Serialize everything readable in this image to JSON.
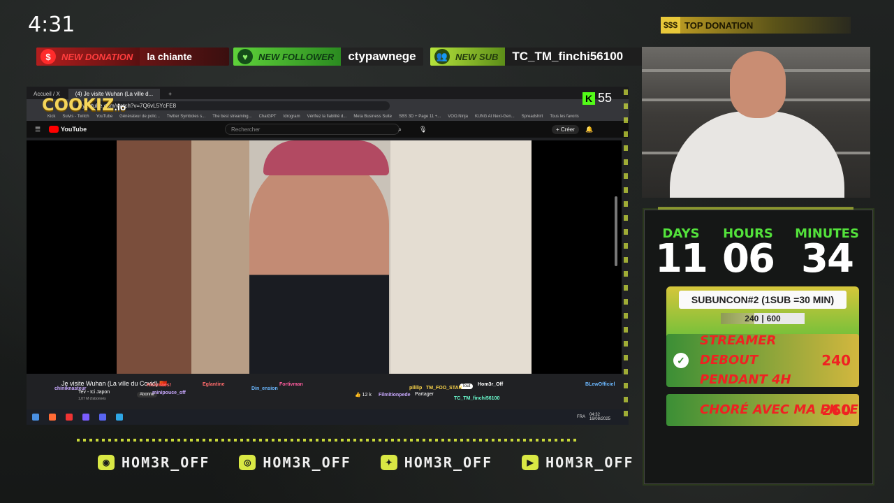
{
  "clock": "4:31",
  "alerts": {
    "donation": {
      "label": "NEW DONATION",
      "value": "la chiante"
    },
    "follower": {
      "label": "NEW FOLLOWER",
      "value": "ctypawnege"
    },
    "sub": {
      "label": "NEW SUB",
      "value": "TC_TM_finchi56100"
    }
  },
  "top_donation": {
    "icon": "$$$",
    "label": "TOP DONATION"
  },
  "browser": {
    "tabs": [
      "Accueil / X",
      "(4) Je visite Wuhan (La ville d..."
    ],
    "url": "youtube.com/watch?v=7Q6vL5YcFE8",
    "bookmarks": [
      "Kick",
      "Suivis - Twitch",
      "YouTube",
      "Générateur de polic...",
      "Twitter Symboles s...",
      "The best streaming...",
      "ChatGPT",
      "Idrogram",
      "Vérifiez la fiabilité d...",
      "Meta Business Suite",
      "SBS 3D + Page 11 +...",
      "VOO.Ninja",
      "KUNG At Next-Gen...",
      "Spreadshirt",
      "Tous les favoris"
    ],
    "cookiz_logo": "COOKIZ",
    "cookiz_tld": ".io",
    "kick_count": "55",
    "youtube_label": "YouTube",
    "search_placeholder": "Rechercher",
    "create_label": "+ Créer",
    "video_title": "Je visite Wuhan (La ville du Covid) 🇨🇳",
    "channel": "Tev - Ici Japon",
    "subscribers": "1,07 M d'abonnés",
    "subscribe": "Abonné",
    "likes": "12 k",
    "share": "Partager",
    "filter": "Tout",
    "taskbar_time": "04:32",
    "taskbar_date": "16/08/2025",
    "taskbar_lang": "FRA"
  },
  "chat_overlay": [
    {
      "name": "chiniknasteur",
      "color": "#c9a9ff"
    },
    {
      "name": "Eglantine",
      "color": "#ff6b6b"
    },
    {
      "name": "Din_ension",
      "color": "#6bb8ff"
    },
    {
      "name": "Kickmaes!",
      "color": "#ff6b6b"
    },
    {
      "name": "minipouce_off",
      "color": "#c9a9ff"
    },
    {
      "name": "Fortivman",
      "color": "#ff5c9e"
    },
    {
      "name": "Hom3r_Off",
      "color": "#ffffff"
    },
    {
      "name": "pililip",
      "color": "#ffd84a"
    },
    {
      "name": "TM_FOO_STAR",
      "color": "#ffd84a"
    },
    {
      "name": "Filmitionpede",
      "color": "#c9a9ff"
    },
    {
      "name": "TC_TM_finchi56100",
      "color": "#6bffd1"
    },
    {
      "name": "BLewOfficiel",
      "color": "#6bb8ff"
    }
  ],
  "subathon": {
    "days_label": "DAYS",
    "days": "11",
    "hours_label": "HOURS",
    "hours": "06",
    "minutes_label": "MINUTES",
    "minutes": "34",
    "title": "SUBUNCON#2 (1SUB =30 MIN)",
    "progress_current": "240",
    "progress_sep": "|",
    "progress_goal": "600",
    "progress_fraction": 0.4,
    "goals": [
      {
        "text": "STREAMER DEBOUT PENDANT 4H",
        "value": "240",
        "done": true
      },
      {
        "text": "CHORÉ AVEC MA FILLE",
        "value": "260",
        "done": false
      }
    ]
  },
  "socials": [
    {
      "icon": "discord-icon",
      "glyph": "◉",
      "name": "HOM3R_OFF"
    },
    {
      "icon": "instagram-icon",
      "glyph": "◎",
      "name": "HOM3R_OFF"
    },
    {
      "icon": "twitter-icon",
      "glyph": "✦",
      "name": "HOM3R_OFF"
    },
    {
      "icon": "youtube-icon",
      "glyph": "▶",
      "name": "HOM3R_OFF"
    }
  ],
  "colors": {
    "accent_green": "#53e23b",
    "accent_lime": "#d9e844",
    "alert_red": "#ff3d3d",
    "goal_red": "#ef2222"
  }
}
